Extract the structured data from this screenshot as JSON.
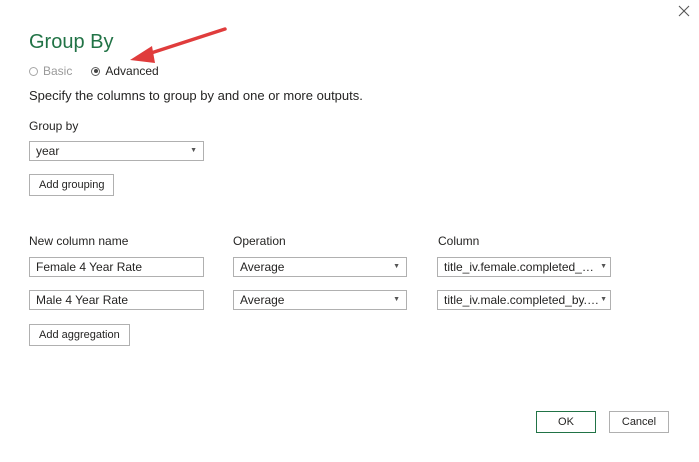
{
  "dialog": {
    "title": "Group By",
    "description": "Specify the columns to group by and one or more outputs.",
    "mode_options": [
      {
        "label": "Basic",
        "selected": false
      },
      {
        "label": "Advanced",
        "selected": true
      }
    ]
  },
  "grouping": {
    "label": "Group by",
    "selected": "year",
    "add_button": "Add grouping"
  },
  "aggregations": {
    "headers": {
      "new_column_name": "New column name",
      "operation": "Operation",
      "column": "Column"
    },
    "rows": [
      {
        "name": "Female 4 Year Rate",
        "operation": "Average",
        "column": "title_iv.female.completed_by..."
      },
      {
        "name": "Male 4 Year Rate",
        "operation": "Average",
        "column": "title_iv.male.completed_by.4..."
      }
    ],
    "add_button": "Add aggregation"
  },
  "footer": {
    "ok": "OK",
    "cancel": "Cancel"
  },
  "colors": {
    "accent": "#217346",
    "annotation_arrow": "#e03c3c"
  },
  "icons": {
    "close": "close-icon",
    "dropdown": "chevron-down-icon",
    "annotation": "red-arrow-annotation"
  }
}
